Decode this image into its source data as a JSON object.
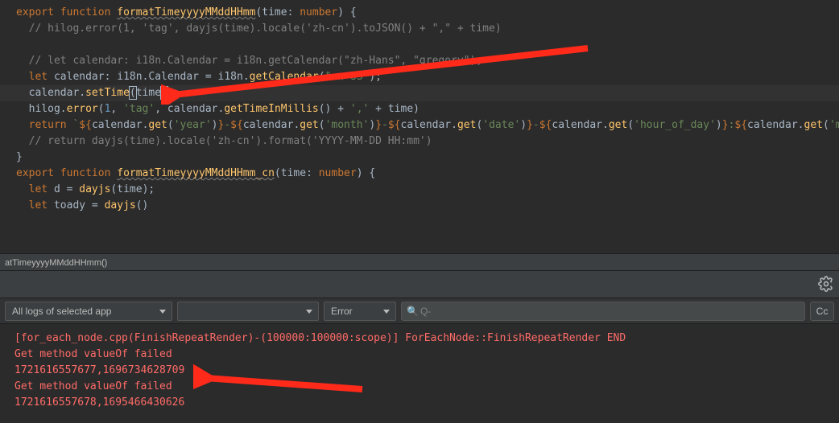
{
  "editor": {
    "lines": [
      {
        "indent": 0,
        "fold": "-",
        "tokens": [
          {
            "t": "export ",
            "c": "kw"
          },
          {
            "t": "function ",
            "c": "kw"
          },
          {
            "t": "formatTimeyyyyMMddHHmm",
            "c": "fn wave"
          },
          {
            "t": "(",
            "c": "op"
          },
          {
            "t": "time",
            "c": "param"
          },
          {
            "t": ": ",
            "c": "op"
          },
          {
            "t": "number",
            "c": "kw"
          },
          {
            "t": ") {",
            "c": "op"
          }
        ]
      },
      {
        "indent": 1,
        "tokens": [
          {
            "t": "// hilog.error(1, 'tag', dayjs(time).locale('zh-cn').toJSON() + \",\" + time)",
            "c": "cmt"
          }
        ]
      },
      {
        "indent": 1,
        "tokens": [
          {
            "t": "",
            "c": ""
          }
        ]
      },
      {
        "indent": 1,
        "tokens": [
          {
            "t": "// let calendar: i18n.Calendar = i18n.getCalendar(\"zh-Hans\", \"gregory\");",
            "c": "cmt"
          }
        ]
      },
      {
        "indent": 1,
        "tokens": [
          {
            "t": "let ",
            "c": "kw"
          },
          {
            "t": "calendar",
            "c": "param"
          },
          {
            "t": ": ",
            "c": "op"
          },
          {
            "t": "i18n",
            "c": "type"
          },
          {
            "t": ".",
            "c": "dot"
          },
          {
            "t": "Calendar",
            "c": "type"
          },
          {
            "t": " = ",
            "c": "op"
          },
          {
            "t": "i18n",
            "c": "type"
          },
          {
            "t": ".",
            "c": "dot"
          },
          {
            "t": "getCalendar",
            "c": "fn"
          },
          {
            "t": "(",
            "c": "op"
          },
          {
            "t": "\"en-US\"",
            "c": "str"
          },
          {
            "t": ");",
            "c": "op"
          }
        ]
      },
      {
        "hl": true,
        "indent": 1,
        "tokens": [
          {
            "t": "calendar",
            "c": "param"
          },
          {
            "t": ".",
            "c": "dot"
          },
          {
            "t": "setTime",
            "c": "fn"
          },
          {
            "t": "(",
            "c": "op paren-match"
          },
          {
            "t": "time",
            "c": "param"
          },
          {
            "t": ")",
            "c": "op paren-match"
          }
        ]
      },
      {
        "indent": 1,
        "tokens": [
          {
            "t": "hilog",
            "c": "type"
          },
          {
            "t": ".",
            "c": "dot"
          },
          {
            "t": "error",
            "c": "fn"
          },
          {
            "t": "(",
            "c": "op"
          },
          {
            "t": "1",
            "c": "num"
          },
          {
            "t": ", ",
            "c": "op"
          },
          {
            "t": "'tag'",
            "c": "str"
          },
          {
            "t": ", ",
            "c": "op"
          },
          {
            "t": "calendar",
            "c": "param"
          },
          {
            "t": ".",
            "c": "dot"
          },
          {
            "t": "getTimeInMillis",
            "c": "fn"
          },
          {
            "t": "() + ",
            "c": "op"
          },
          {
            "t": "','",
            "c": "str"
          },
          {
            "t": " + ",
            "c": "op"
          },
          {
            "t": "time",
            "c": "param"
          },
          {
            "t": ")",
            "c": "op"
          }
        ]
      },
      {
        "indent": 1,
        "tokens": [
          {
            "t": "return ",
            "c": "kw"
          },
          {
            "t": "`",
            "c": "str"
          },
          {
            "t": "${",
            "c": "kw"
          },
          {
            "t": "calendar",
            "c": "param"
          },
          {
            "t": ".",
            "c": "dot"
          },
          {
            "t": "get",
            "c": "fn"
          },
          {
            "t": "(",
            "c": "op"
          },
          {
            "t": "'year'",
            "c": "str"
          },
          {
            "t": ")",
            "c": "op"
          },
          {
            "t": "}",
            "c": "kw"
          },
          {
            "t": "-",
            "c": "str"
          },
          {
            "t": "${",
            "c": "kw"
          },
          {
            "t": "calendar",
            "c": "param"
          },
          {
            "t": ".",
            "c": "dot"
          },
          {
            "t": "get",
            "c": "fn"
          },
          {
            "t": "(",
            "c": "op"
          },
          {
            "t": "'month'",
            "c": "str"
          },
          {
            "t": ")",
            "c": "op"
          },
          {
            "t": "}",
            "c": "kw"
          },
          {
            "t": "-",
            "c": "str"
          },
          {
            "t": "${",
            "c": "kw"
          },
          {
            "t": "calendar",
            "c": "param"
          },
          {
            "t": ".",
            "c": "dot"
          },
          {
            "t": "get",
            "c": "fn"
          },
          {
            "t": "(",
            "c": "op"
          },
          {
            "t": "'date'",
            "c": "str"
          },
          {
            "t": ")",
            "c": "op"
          },
          {
            "t": "}",
            "c": "kw"
          },
          {
            "t": "-",
            "c": "str"
          },
          {
            "t": "${",
            "c": "kw"
          },
          {
            "t": "calendar",
            "c": "param"
          },
          {
            "t": ".",
            "c": "dot"
          },
          {
            "t": "get",
            "c": "fn"
          },
          {
            "t": "(",
            "c": "op"
          },
          {
            "t": "'hour_of_day'",
            "c": "str"
          },
          {
            "t": ")",
            "c": "op"
          },
          {
            "t": "}",
            "c": "kw"
          },
          {
            "t": ":",
            "c": "str"
          },
          {
            "t": "${",
            "c": "kw"
          },
          {
            "t": "calendar",
            "c": "param"
          },
          {
            "t": ".",
            "c": "dot"
          },
          {
            "t": "get",
            "c": "fn"
          },
          {
            "t": "(",
            "c": "op"
          },
          {
            "t": "'minute'",
            "c": "str"
          },
          {
            "t": ")",
            "c": "op"
          },
          {
            "t": "}",
            "c": "kw"
          },
          {
            "t": "`",
            "c": "str"
          }
        ]
      },
      {
        "indent": 1,
        "tokens": [
          {
            "t": "// return dayjs(time).locale('zh-cn').format('YYYY-MM-DD HH:mm')",
            "c": "cmt"
          }
        ]
      },
      {
        "indent": 0,
        "fold": "end",
        "tokens": [
          {
            "t": "}",
            "c": "op"
          }
        ]
      },
      {
        "indent": 0,
        "tokens": [
          {
            "t": "",
            "c": ""
          }
        ]
      },
      {
        "indent": 0,
        "fold": "-",
        "tokens": [
          {
            "t": "export ",
            "c": "kw"
          },
          {
            "t": "function ",
            "c": "kw"
          },
          {
            "t": "formatTimeyyyyMMddHHmm_cn",
            "c": "fn wave"
          },
          {
            "t": "(",
            "c": "op"
          },
          {
            "t": "time",
            "c": "param"
          },
          {
            "t": ": ",
            "c": "op"
          },
          {
            "t": "number",
            "c": "kw"
          },
          {
            "t": ") {",
            "c": "op"
          }
        ]
      },
      {
        "indent": 0,
        "tokens": [
          {
            "t": "",
            "c": ""
          }
        ]
      },
      {
        "indent": 1,
        "tokens": [
          {
            "t": "let ",
            "c": "kw"
          },
          {
            "t": "d",
            "c": "param"
          },
          {
            "t": " = ",
            "c": "op"
          },
          {
            "t": "dayjs",
            "c": "fn"
          },
          {
            "t": "(",
            "c": "op"
          },
          {
            "t": "time",
            "c": "param"
          },
          {
            "t": ");",
            "c": "op"
          }
        ]
      },
      {
        "indent": 1,
        "tokens": [
          {
            "t": "let ",
            "c": "kw"
          },
          {
            "t": "toady",
            "c": "param"
          },
          {
            "t": " = ",
            "c": "op"
          },
          {
            "t": "dayjs",
            "c": "fn"
          },
          {
            "t": "()",
            "c": "op"
          }
        ]
      }
    ]
  },
  "breadcrumb": {
    "text": "atTimeyyyyMMddHHmm()"
  },
  "filters": {
    "scope": "All logs of selected app",
    "device": "",
    "level": "Error",
    "search_prefix": "Q-",
    "cc": "Cc"
  },
  "log": {
    "lines": [
      "[for_each_node.cpp(FinishRepeatRender)-(100000:100000:scope)] ForEachNode::FinishRepeatRender END",
      "Get method valueOf failed",
      "1721616557677,1696734628709",
      "Get method valueOf failed",
      "1721616557678,1695466430626"
    ]
  }
}
